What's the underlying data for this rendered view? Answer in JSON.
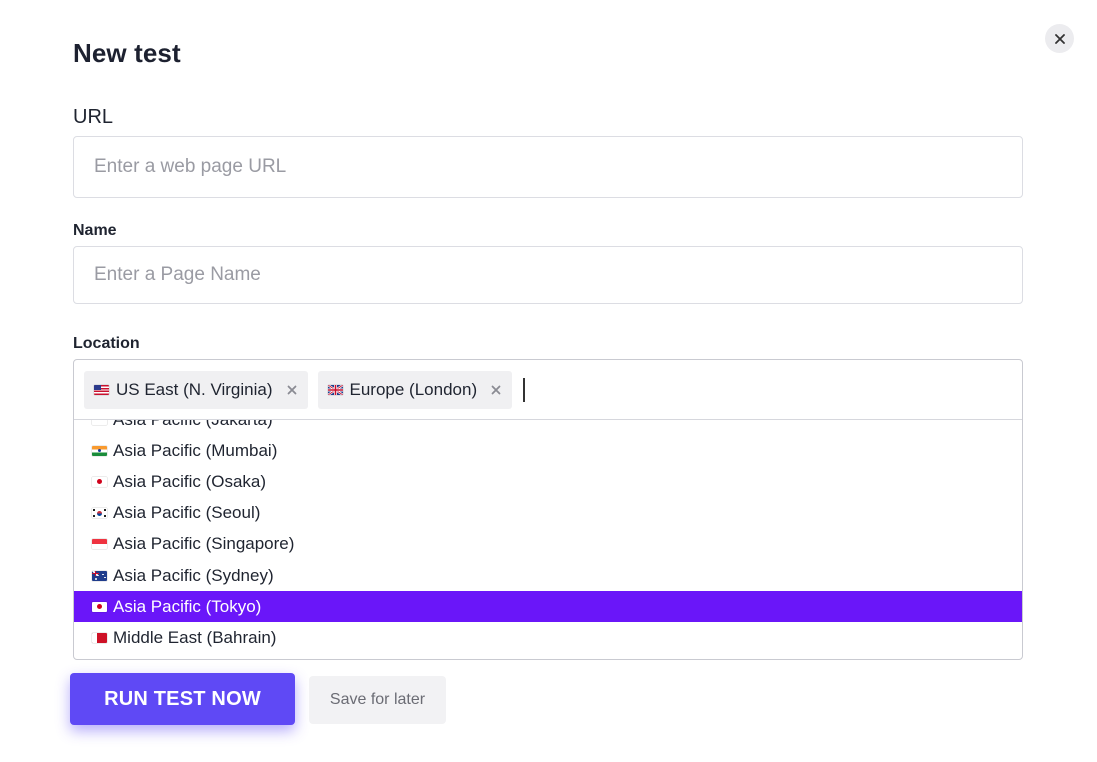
{
  "modal": {
    "title": "New test",
    "close_icon": "close-icon"
  },
  "url_field": {
    "label": "URL",
    "placeholder": "Enter a web page URL",
    "value": ""
  },
  "name_field": {
    "label": "Name",
    "placeholder": "Enter a Page Name",
    "value": ""
  },
  "location_field": {
    "label": "Location",
    "selected": [
      {
        "label": "US East (N. Virginia)",
        "flag": "us"
      },
      {
        "label": "Europe (London)",
        "flag": "gb"
      }
    ],
    "options": [
      {
        "label": "Asia Pacific (Jakarta)",
        "flag": "id",
        "active": false
      },
      {
        "label": "Asia Pacific (Mumbai)",
        "flag": "in",
        "active": false
      },
      {
        "label": "Asia Pacific (Osaka)",
        "flag": "jp",
        "active": false
      },
      {
        "label": "Asia Pacific (Seoul)",
        "flag": "kr",
        "active": false
      },
      {
        "label": "Asia Pacific (Singapore)",
        "flag": "sg",
        "active": false
      },
      {
        "label": "Asia Pacific (Sydney)",
        "flag": "au",
        "active": false
      },
      {
        "label": "Asia Pacific (Tokyo)",
        "flag": "jp",
        "active": true
      },
      {
        "label": "Middle East (Bahrain)",
        "flag": "bh",
        "active": false
      }
    ]
  },
  "actions": {
    "run_label": "RUN TEST NOW",
    "save_label": "Save for later"
  },
  "colors": {
    "primary": "#5f49f5",
    "active_option": "#6a16f9"
  }
}
